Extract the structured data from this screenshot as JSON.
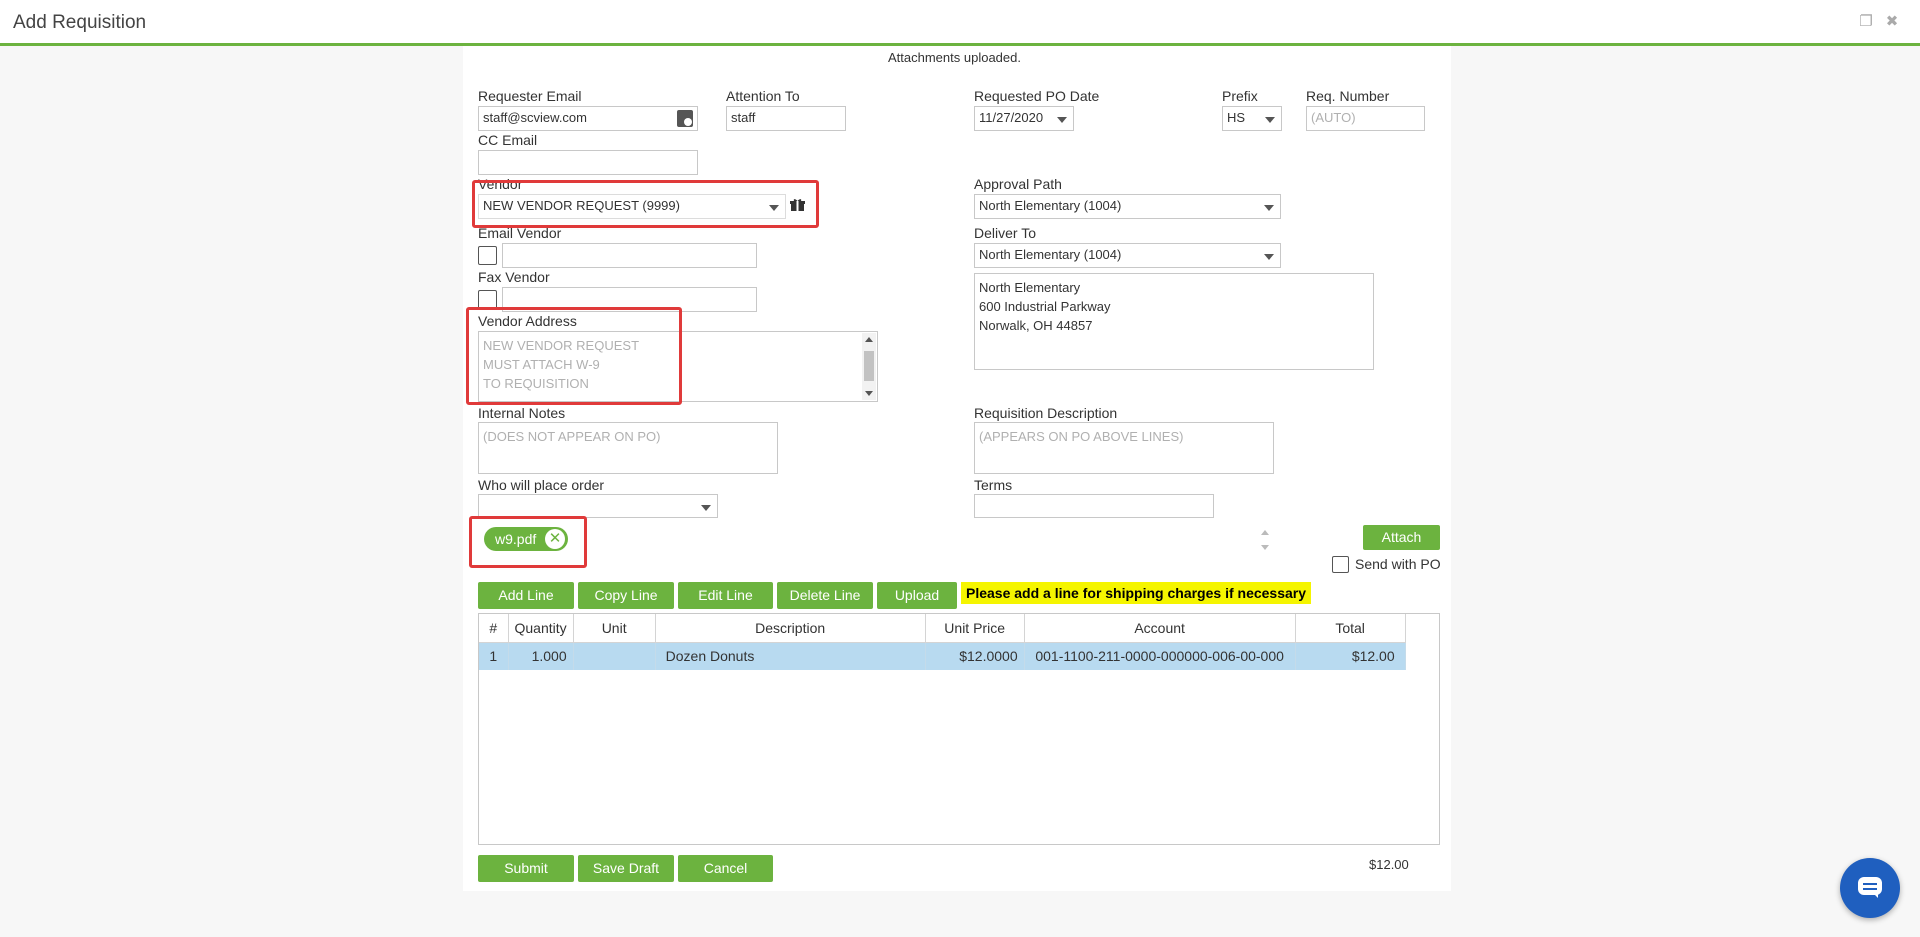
{
  "window": {
    "title": "Add Requisition"
  },
  "status_message": "Attachments uploaded.",
  "form": {
    "requester_email": {
      "label": "Requester Email",
      "value": "staff@scview.com"
    },
    "attention_to": {
      "label": "Attention To",
      "value": "staff"
    },
    "requested_po_date": {
      "label": "Requested PO Date",
      "value": "11/27/2020"
    },
    "prefix": {
      "label": "Prefix",
      "value": "HS"
    },
    "req_number": {
      "label": "Req. Number",
      "placeholder": "(AUTO)"
    },
    "cc_email": {
      "label": "CC Email",
      "value": ""
    },
    "vendor": {
      "label": "Vendor",
      "value": "NEW VENDOR REQUEST (9999)"
    },
    "approval_path": {
      "label": "Approval Path",
      "value": "North Elementary (1004)"
    },
    "email_vendor": {
      "label": "Email Vendor",
      "checked": false,
      "value": ""
    },
    "deliver_to": {
      "label": "Deliver To",
      "value": "North Elementary (1004)"
    },
    "deliver_address": {
      "line1": "North Elementary",
      "line2": "600 Industrial Parkway",
      "line3": "Norwalk, OH  44857"
    },
    "fax_vendor": {
      "label": "Fax Vendor",
      "checked": false,
      "value": ""
    },
    "vendor_address": {
      "label": "Vendor Address",
      "line1": "NEW VENDOR REQUEST",
      "line2": "MUST ATTACH W-9",
      "line3": "TO REQUISITION"
    },
    "internal_notes": {
      "label": "Internal Notes",
      "placeholder": "(DOES NOT APPEAR ON PO)"
    },
    "requisition_description": {
      "label": "Requisition Description",
      "placeholder": "(APPEARS ON PO ABOVE LINES)"
    },
    "who_will_place_order": {
      "label": "Who will place order",
      "value": ""
    },
    "terms": {
      "label": "Terms",
      "value": ""
    }
  },
  "attachment": {
    "file_name": "w9.pdf",
    "remove_icon": "close-circle-icon"
  },
  "attach_button": "Attach",
  "send_with_po": {
    "label": "Send with PO",
    "checked": false
  },
  "line_toolbar": {
    "add_line": "Add Line",
    "copy_line": "Copy Line",
    "edit_line": "Edit Line",
    "delete_line": "Delete Line",
    "upload": "Upload",
    "notice": "Please add a line for shipping charges if necessary"
  },
  "lines_table": {
    "columns": [
      "#",
      "Quantity",
      "Unit",
      "Description",
      "Unit Price",
      "Account",
      "Total"
    ],
    "rows": [
      [
        "1",
        "1.000",
        "",
        "Dozen Donuts",
        "$12.0000",
        "001-1100-211-0000-000000-006-00-000",
        "$12.00"
      ]
    ]
  },
  "grand_total": "$12.00",
  "footer_buttons": {
    "submit": "Submit",
    "save_draft": "Save Draft",
    "cancel": "Cancel"
  },
  "colors": {
    "accent": "#6cb33f",
    "highlight": "#e03a3a",
    "notice_bg": "#f5f500",
    "selected_row": "#b8daf0"
  },
  "icons": {
    "vendor_lookup": "gift-icon",
    "address_book": "address-book-icon",
    "chat": "chat-icon",
    "restore": "restore-window-icon",
    "close": "close-icon"
  }
}
